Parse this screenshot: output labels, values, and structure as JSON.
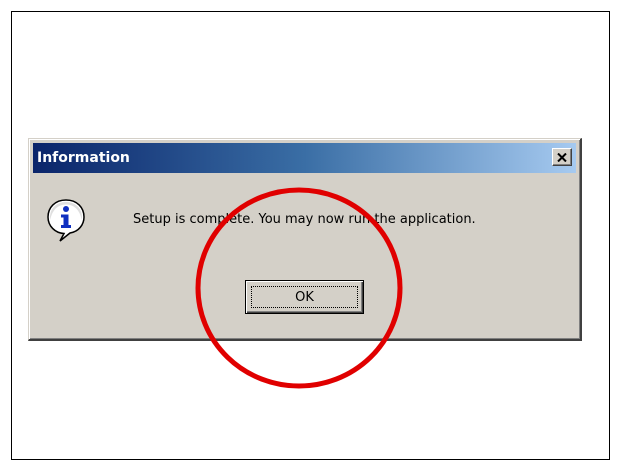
{
  "dialog": {
    "title": "Information",
    "close_label": "×",
    "message": "Setup is complete. You may now run the application.",
    "icon": "information-icon",
    "ok_label": "OK"
  },
  "annotation": {
    "shape": "circle",
    "color": "#e00000",
    "target": "ok-button"
  },
  "colors": {
    "titlebar_start": "#0a246a",
    "titlebar_end": "#a6caf0",
    "dialog_face": "#d4d0c8"
  }
}
